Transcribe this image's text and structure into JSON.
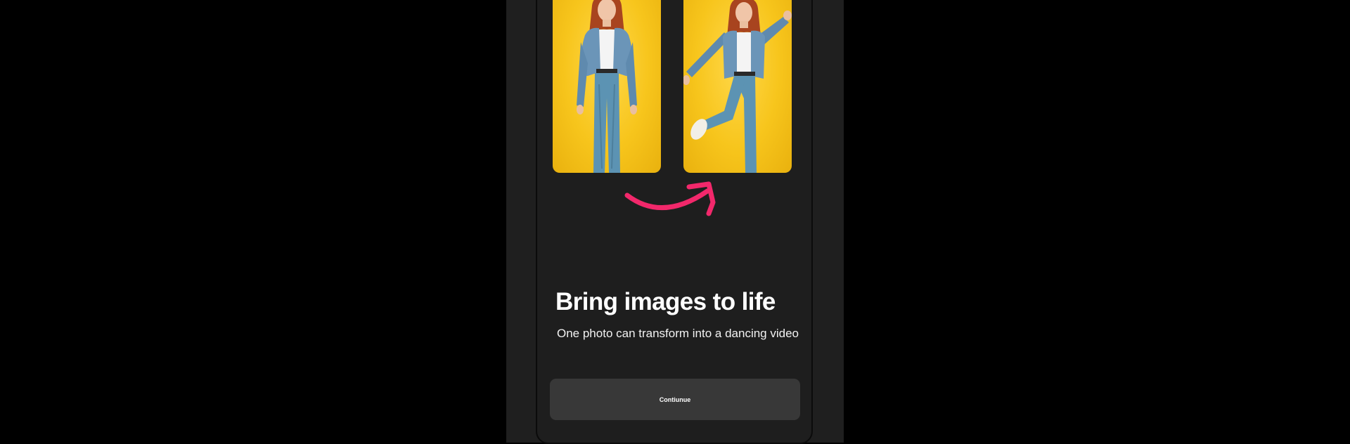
{
  "onboarding": {
    "title": "Bring images to life",
    "subtitle": "One photo can transform into a dancing video",
    "continue_label": "Contiunue"
  },
  "illustration": {
    "before_image": "woman-standing-photo",
    "after_image": "woman-dancing-photo",
    "arrow_icon": "curved-arrow-icon"
  },
  "colors": {
    "background": "#1e1e1e",
    "photo_background": "#f7c51c",
    "arrow_accent": "#f2286b",
    "button": "#383838",
    "text": "#ffffff"
  }
}
